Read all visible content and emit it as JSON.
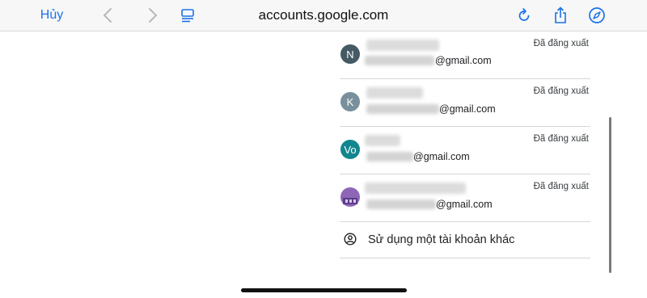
{
  "toolbar": {
    "cancel_label": "Hủy",
    "url": "accounts.google.com",
    "icons": [
      "chevron-left-icon",
      "chevron-right-icon",
      "tab-overview-icon",
      "reload-icon",
      "share-icon",
      "compass-icon"
    ]
  },
  "accounts": [
    {
      "initial": "N",
      "avatar_color": "#455a64",
      "email_suffix": "@gmail.com",
      "status": "Đã đăng xuất"
    },
    {
      "initial": "K",
      "avatar_color": "#78909c",
      "email_suffix": "@gmail.com",
      "status": "Đã đăng xuất"
    },
    {
      "initial": "Vo",
      "avatar_color": "#12868f",
      "email_suffix": "@gmail.com",
      "status": "Đã đăng xuất"
    },
    {
      "initial": "",
      "avatar_color": "#8e66b8",
      "email_suffix": "@gmail.com",
      "status": "Đã đăng xuất"
    }
  ],
  "use_another_account": "Sử dụng một tài khoản khác",
  "colors": {
    "accent": "#1a73e8"
  }
}
